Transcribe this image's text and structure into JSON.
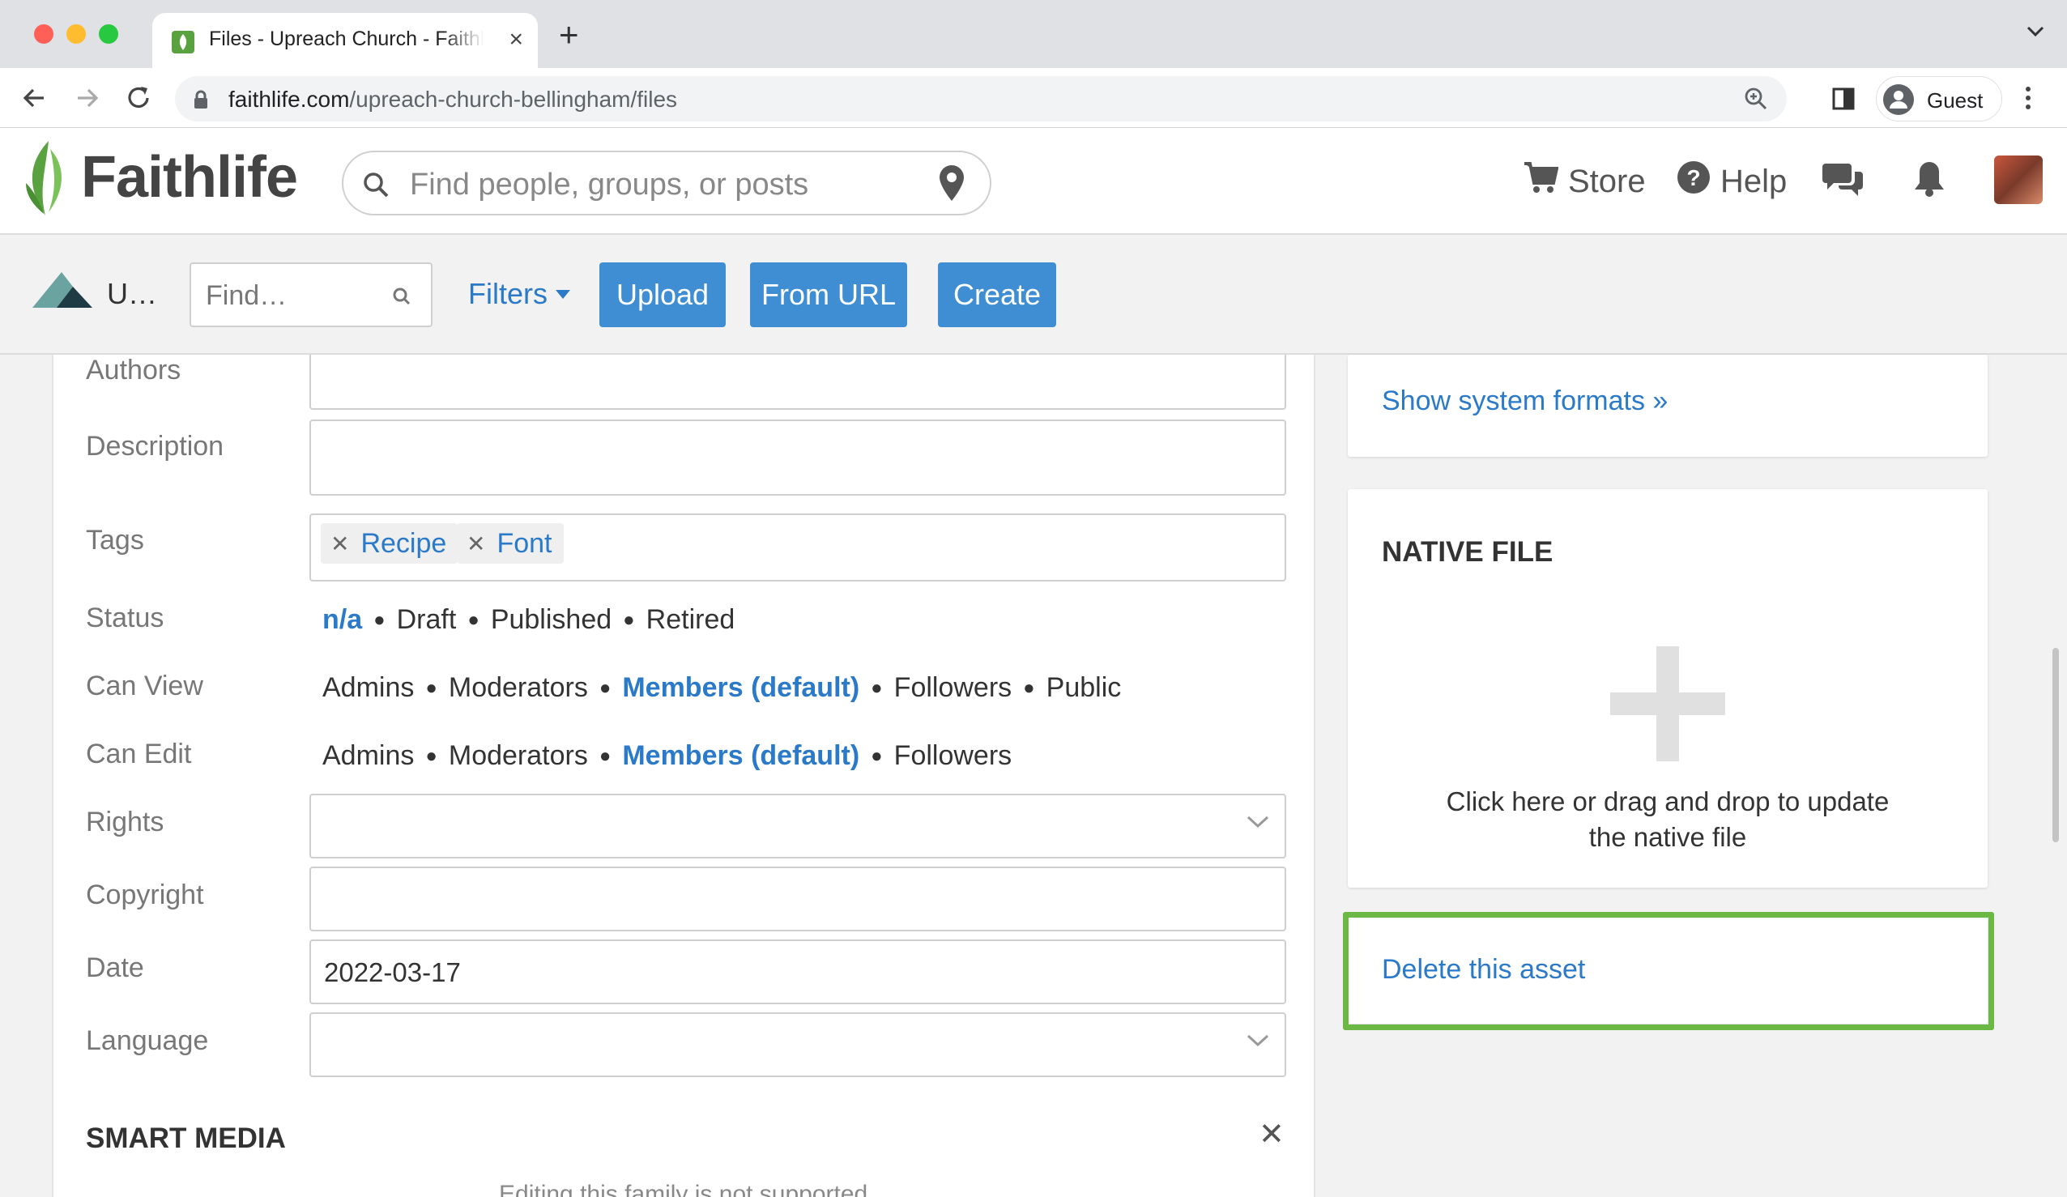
{
  "browser": {
    "tab_title": "Files - Upreach Church - Faithlife",
    "url_domain": "faithlife.com",
    "url_path": "/upreach-church-bellingham/files",
    "profile_label": "Guest"
  },
  "header": {
    "logo_text": "Faithlife",
    "search_placeholder": "Find people, groups, or posts",
    "store_label": "Store",
    "help_label": "Help"
  },
  "files_toolbar": {
    "group_name": "U…",
    "find_placeholder": "Find…",
    "filters_label": "Filters",
    "upload_label": "Upload",
    "from_url_label": "From URL",
    "create_label": "Create"
  },
  "form": {
    "authors_label": "Authors",
    "description_label": "Description",
    "tags_label": "Tags",
    "tags": [
      "Recipe",
      "Font"
    ],
    "status_label": "Status",
    "status_options": [
      "n/a",
      "Draft",
      "Published",
      "Retired"
    ],
    "can_view_label": "Can View",
    "can_view_options": [
      "Admins",
      "Moderators",
      "Members (default)",
      "Followers",
      "Public"
    ],
    "can_edit_label": "Can Edit",
    "can_edit_options": [
      "Admins",
      "Moderators",
      "Members (default)",
      "Followers"
    ],
    "rights_label": "Rights",
    "copyright_label": "Copyright",
    "date_label": "Date",
    "date_value": "2022-03-17",
    "language_label": "Language",
    "smart_media_title": "SMART MEDIA",
    "smart_media_note": "Editing this family is not supported"
  },
  "sidebar": {
    "show_formats_link": "Show system formats »",
    "native_file_title": "NATIVE FILE",
    "native_file_text_1": "Click here or drag and drop to update",
    "native_file_text_2": "the native file",
    "delete_link": "Delete this asset"
  },
  "colors": {
    "link_blue": "#2a7ac9",
    "button_blue": "#3f8ed3",
    "highlight_green": "#6cb845",
    "brand_green": "#5aa23f"
  }
}
